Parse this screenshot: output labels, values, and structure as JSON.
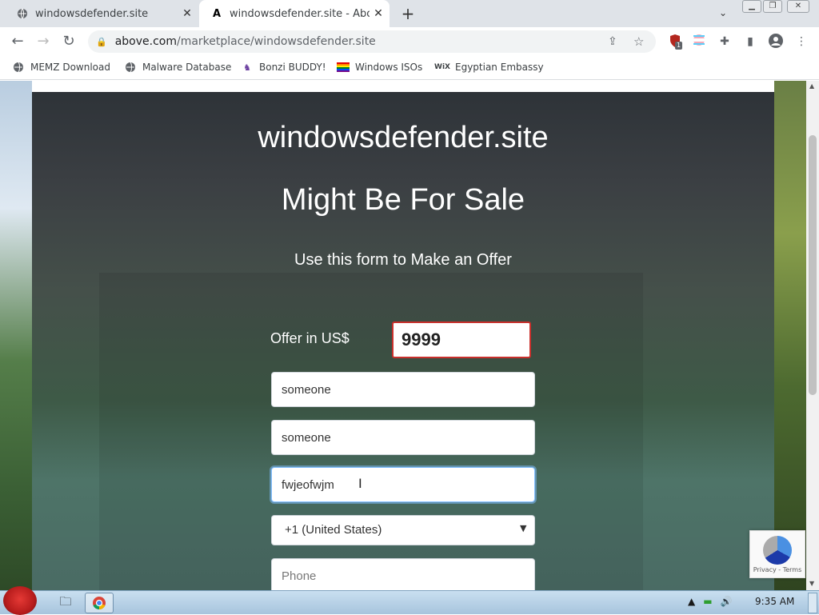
{
  "browser": {
    "tabs": [
      {
        "title": "windowsdefender.site",
        "active": false
      },
      {
        "title": "windowsdefender.site - Above",
        "active": true
      }
    ],
    "url": {
      "host": "above.com",
      "path": "/marketplace/windowsdefender.site"
    },
    "bookmarks": [
      {
        "label": "MEMZ Download"
      },
      {
        "label": "Malware Database"
      },
      {
        "label": "Bonzi BUDDY!"
      },
      {
        "label": "Windows ISOs"
      },
      {
        "label": "Egyptian Embassy"
      }
    ],
    "extension_badge": "1"
  },
  "page": {
    "domain": "windowsdefender.site",
    "subtitle": "Might Be For Sale",
    "form_title": "Use this form to Make an Offer",
    "offer_label": "Offer in US$",
    "offer_value": "9999",
    "field_first_name": "someone",
    "field_last_name": "someone",
    "field_email": "fwjeofwjm",
    "country_select": "+1 (United States)",
    "phone_placeholder": "Phone"
  },
  "recaptcha": {
    "text": "Privacy - Terms"
  },
  "taskbar": {
    "clock": "9:35 AM"
  },
  "colors": {
    "offer_border": "#c9302c",
    "focus_ring": "#80bdff",
    "accent": "#1a73e8"
  }
}
